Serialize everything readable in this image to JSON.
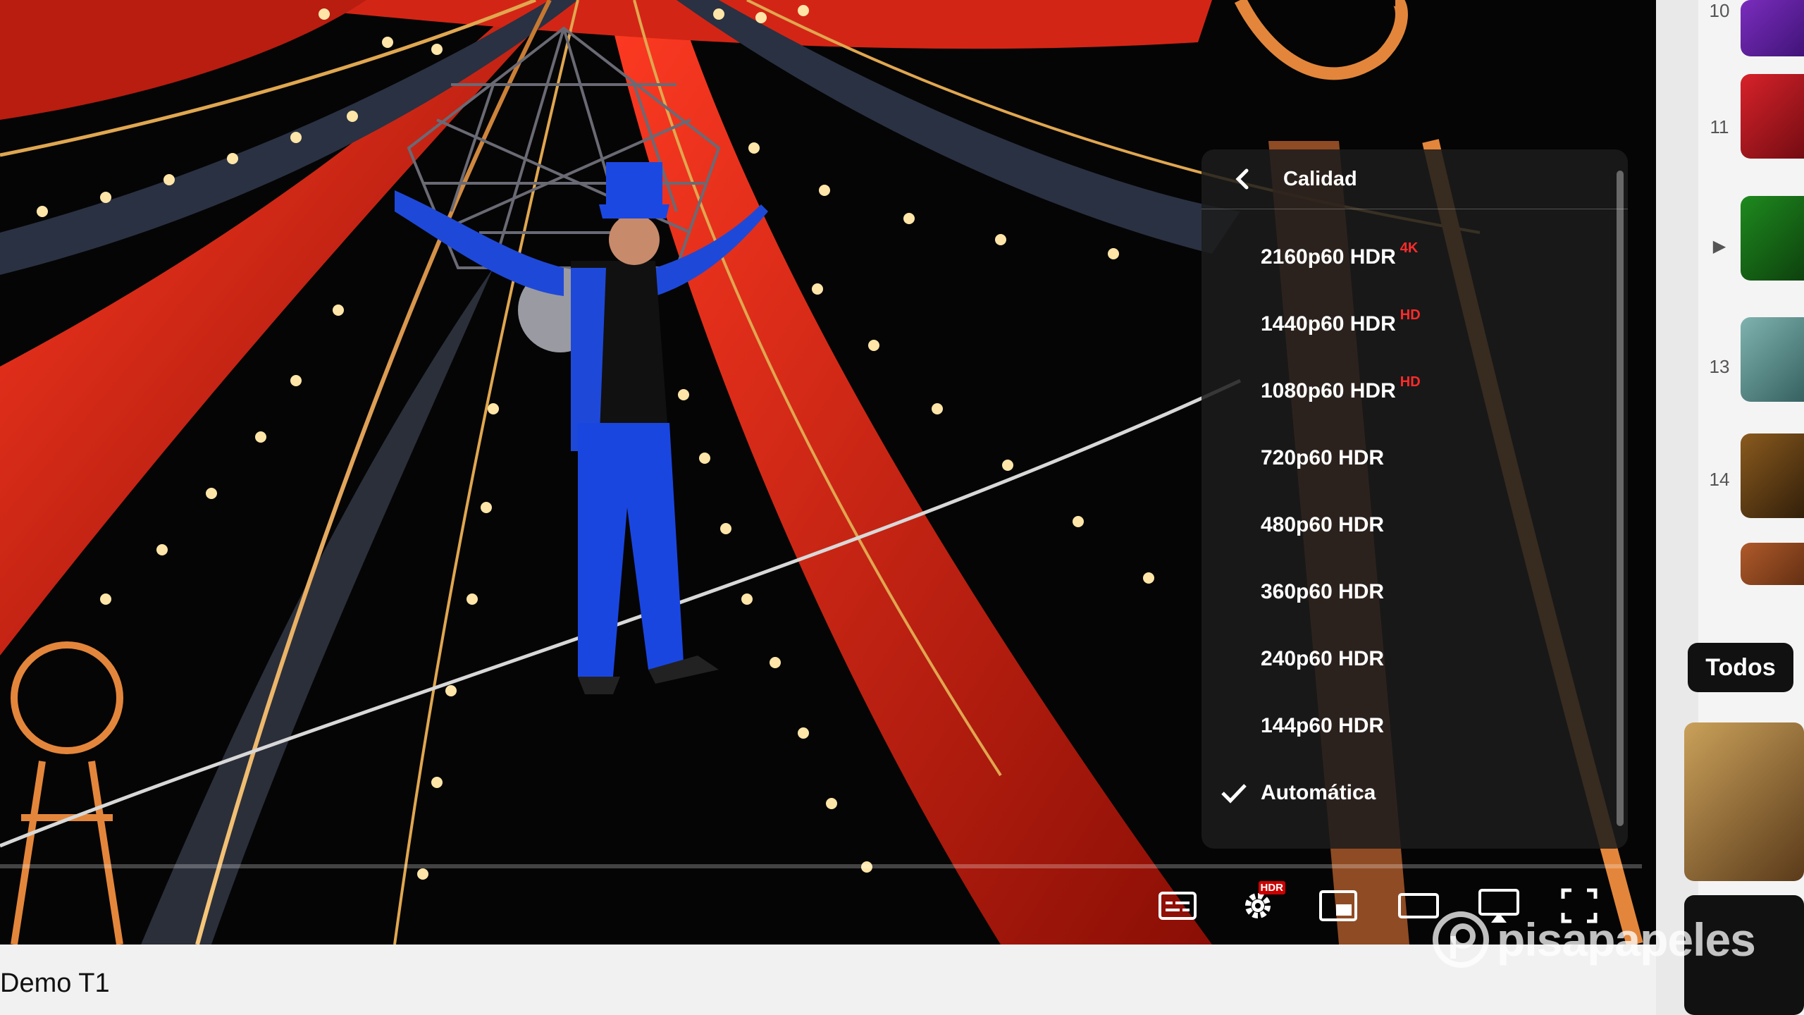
{
  "player": {
    "settings_hdr_badge": "HDR",
    "quality_menu": {
      "title": "Calidad",
      "options": [
        {
          "label": "2160p60 HDR",
          "badge": "4K",
          "selected": false
        },
        {
          "label": "1440p60 HDR",
          "badge": "HD",
          "selected": false
        },
        {
          "label": "1080p60 HDR",
          "badge": "HD",
          "selected": false
        },
        {
          "label": "720p60 HDR",
          "badge": "",
          "selected": false
        },
        {
          "label": "480p60 HDR",
          "badge": "",
          "selected": false
        },
        {
          "label": "360p60 HDR",
          "badge": "",
          "selected": false
        },
        {
          "label": "240p60 HDR",
          "badge": "",
          "selected": false
        },
        {
          "label": "144p60 HDR",
          "badge": "",
          "selected": false
        },
        {
          "label": "Automática",
          "badge": "",
          "selected": true
        }
      ]
    }
  },
  "video": {
    "title": "Demo T1"
  },
  "sidebar": {
    "ranks": [
      "10",
      "11",
      "",
      "13",
      "14"
    ],
    "chip_label": "Todos"
  },
  "watermark": {
    "text": "pisapapeles"
  },
  "colors": {
    "badge_red": "#ff2b2b",
    "menu_bg": "#1c1c1c",
    "curtain_red": "#e0261a"
  },
  "icons": [
    "chevron-left-icon",
    "check-icon",
    "subtitles-icon",
    "gear-icon",
    "miniplayer-icon",
    "theater-icon",
    "cast-icon",
    "fullscreen-icon"
  ]
}
